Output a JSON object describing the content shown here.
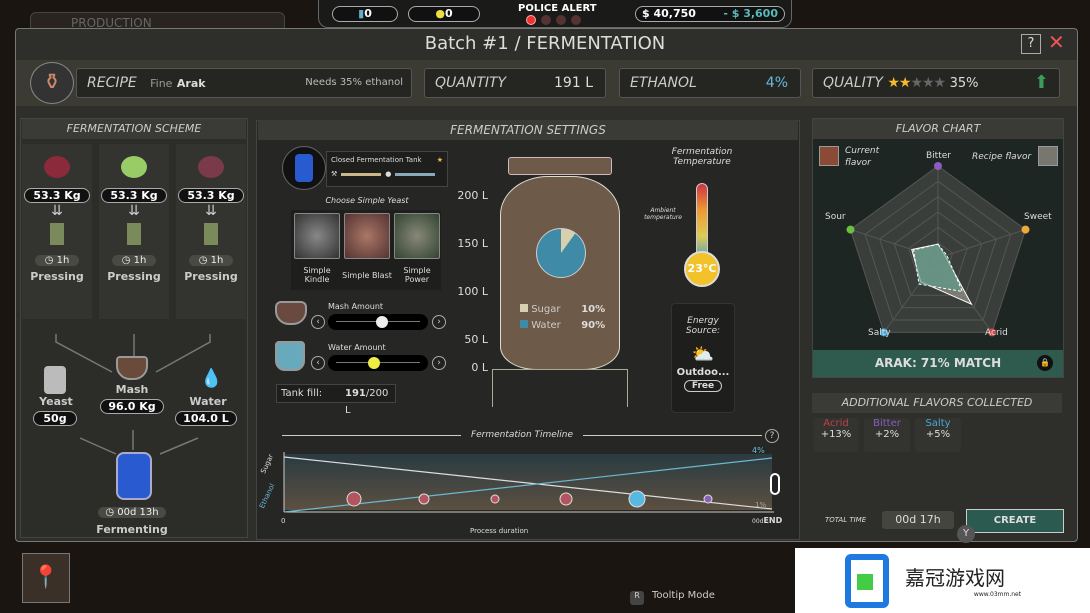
{
  "topbar": {
    "production_tab": "PRODUCTION",
    "counter1": "0",
    "counter2": "0",
    "police_alert": "POLICE ALERT",
    "police_level": 1,
    "police_max": 4,
    "money": "$ 40,750",
    "money_change": "- $ 3,600"
  },
  "window": {
    "title": "Batch #1 / FERMENTATION",
    "help": "?",
    "close": "✕"
  },
  "stats": {
    "recipe_label": "RECIPE",
    "recipe_quality": "Fine",
    "recipe_name": "Arak",
    "recipe_needs": "Needs 35% ethanol",
    "quantity_label": "QUANTITY",
    "quantity": "191 L",
    "ethanol_label": "ETHANOL",
    "ethanol": "4%",
    "quality_label": "QUALITY",
    "quality_stars": 2,
    "quality_max_stars": 5,
    "quality": "35%"
  },
  "scheme": {
    "title": "FERMENTATION SCHEME",
    "ingredients": [
      {
        "icon": "grapes-icon",
        "amount": "53.3 Kg",
        "time": "1h",
        "process": "Pressing"
      },
      {
        "icon": "apple-icon",
        "amount": "53.3 Kg",
        "time": "1h",
        "process": "Pressing"
      },
      {
        "icon": "plum-icon",
        "amount": "53.3 Kg",
        "time": "1h",
        "process": "Pressing"
      }
    ],
    "yeast_label": "Yeast",
    "yeast": "50g",
    "mash_label": "Mash",
    "mash": "96.0 Kg",
    "water_label": "Water",
    "water": "104.0 L",
    "ferment_time": "00d 13h",
    "ferment_label": "Fermenting"
  },
  "settings": {
    "title": "FERMENTATION SETTINGS",
    "tank_name": "Closed Fermentation Tank",
    "choose_yeast": "Choose Simple Yeast",
    "yeasts": [
      "Simple Kindle",
      "Simple Blast",
      "Simple Power"
    ],
    "mash_amount": "Mash Amount",
    "mash_slider": 0.55,
    "water_amount": "Water Amount",
    "water_slider": 0.45,
    "tank_fill_label": "Tank fill:",
    "tank_fill": "191",
    "tank_capacity": "/200 L",
    "scale": [
      "200 L",
      "150 L",
      "100 L",
      "50 L",
      "0 L"
    ],
    "sugar_label": "Sugar",
    "sugar_pct": "10%",
    "water_label": "Water",
    "water_pct": "90%",
    "sugar_color": "#d8cfae",
    "water_color": "#3f8aa6",
    "temp_title": "Fermentation Temperature",
    "ambient": "Ambient temperature",
    "temp": "23°C",
    "energy_label": "Energy Source:",
    "energy": "Outdoo...",
    "energy_cost": "Free"
  },
  "timeline": {
    "title": "Fermentation Timeline",
    "help": "?",
    "y_sugar": "Sugar",
    "y_ethanol": "Ethanol",
    "x_start": "0",
    "x_end": "00d",
    "end": "END",
    "xlabel": "Process duration",
    "ethanol_end": "4%",
    "sugar_end": "1%"
  },
  "flavor": {
    "title": "FLAVOR CHART",
    "current": "Current flavor",
    "recipe": "Recipe flavor",
    "current_color": "#8a4a36",
    "recipe_color": "#77776f",
    "axes": [
      {
        "name": "Bitter",
        "color": "#8a5cc0"
      },
      {
        "name": "Sweet",
        "color": "#f0a83a"
      },
      {
        "name": "Acrid",
        "color": "#d04a4a"
      },
      {
        "name": "Salty",
        "color": "#4aa8d8"
      },
      {
        "name": "Sour",
        "color": "#6ac040"
      }
    ],
    "match": "ARAK: 71% MATCH",
    "additional_title": "ADDITIONAL FLAVORS COLLECTED",
    "additional": [
      {
        "name": "Acrid",
        "value": "+13%",
        "color": "#c0404a"
      },
      {
        "name": "Bitter",
        "value": "+2%",
        "color": "#8a5cc0"
      },
      {
        "name": "Salty",
        "value": "+5%",
        "color": "#4aa8d8"
      }
    ]
  },
  "footer": {
    "total_time_label": "TOTAL TIME",
    "total_time": "00d 17h",
    "create": "CREATE",
    "y_key": "Y",
    "tooltip_key": "R",
    "tooltip_mode": "Tooltip Mode"
  },
  "watermark": "嘉冠游戏网 www.03mm.net"
}
